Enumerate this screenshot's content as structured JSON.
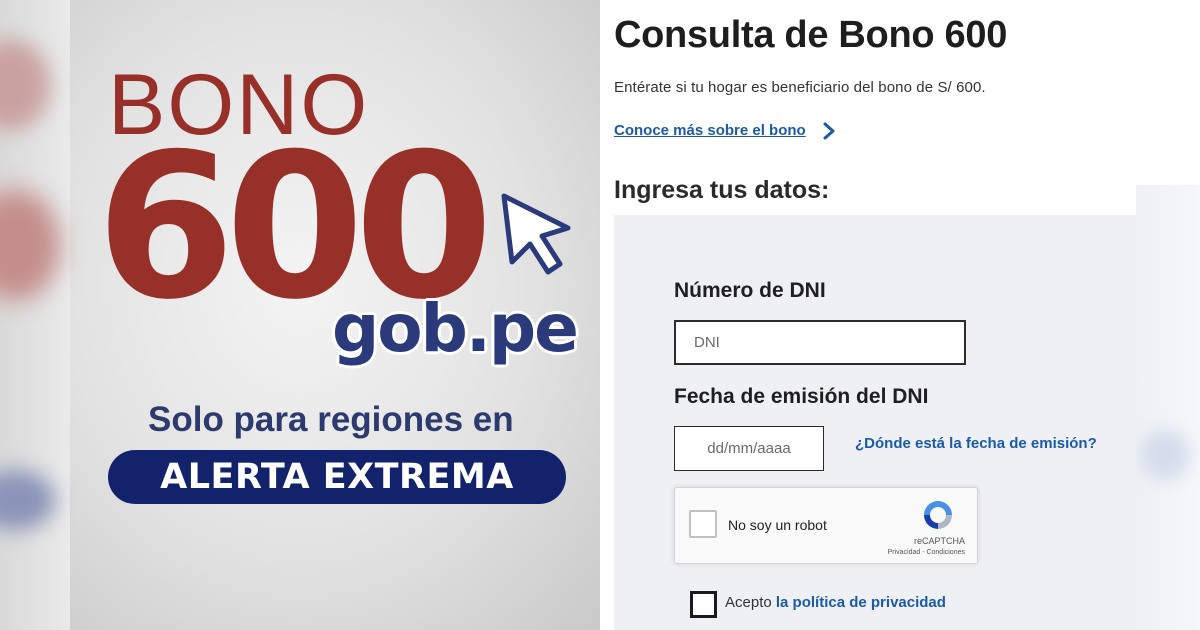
{
  "banner": {
    "bono_word": "BONO",
    "amount": "600",
    "gobpe": "gob.pe",
    "regions_text": "Solo para regiones en",
    "alert_text": "ALERTA EXTREMA",
    "colors": {
      "brand_red": "#973029",
      "brand_navy": "#13236b"
    }
  },
  "form": {
    "title": "Consulta de Bono 600",
    "subtitle": "Entérate si tu hogar es beneficiario del bono de S/ 600.",
    "more_link": "Conoce más sobre el bono",
    "section_title": "Ingresa tus datos:",
    "dni": {
      "label": "Número de DNI",
      "placeholder": "DNI",
      "value": ""
    },
    "fecha": {
      "label": "Fecha de emisión del DNI",
      "placeholder": "dd/mm/aaaa",
      "value": "",
      "help_link": "¿Dónde está la fecha de emisión?"
    },
    "captcha": {
      "label": "No soy un robot",
      "brand": "reCAPTCHA",
      "links": "Privacidad - Condiciones",
      "checked": false
    },
    "privacy": {
      "prefix": "Acepto",
      "link": "la política de privacidad",
      "checked": false
    },
    "colors": {
      "link_blue": "#1c5aa8",
      "panel_bg": "#eef0f4"
    }
  }
}
